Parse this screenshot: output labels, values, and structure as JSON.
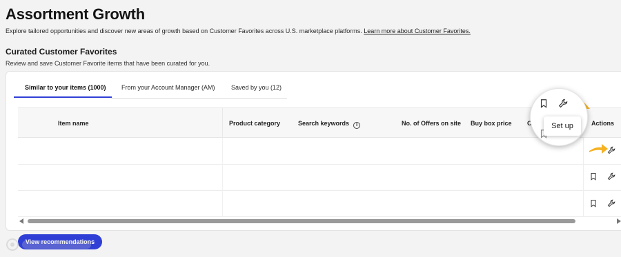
{
  "header": {
    "title": "Assortment Growth",
    "description": "Explore tailored opportunities and discover new areas of growth based on Customer Favorites across U.S. marketplace platforms.",
    "link": "Learn more about Customer Favorites."
  },
  "section": {
    "title": "Curated Customer Favorites",
    "description": "Review and save Customer Favorite items that have been curated for you."
  },
  "tabs": [
    {
      "label": "Similar to your items (1000)",
      "active": true
    },
    {
      "label": "From your Account Manager (AM)",
      "active": false
    },
    {
      "label": "Saved by you (12)",
      "active": false
    }
  ],
  "table": {
    "columns": [
      "Item name",
      "Product category",
      "Search keywords",
      "No. of Offers on site",
      "Buy box price",
      "C",
      "Actions"
    ],
    "rows": [
      {
        "actions": [
          "bookmark-icon",
          "wrench-icon"
        ]
      },
      {
        "actions": [
          "bookmark-icon",
          "wrench-icon"
        ]
      },
      {
        "actions": [
          "bookmark-icon",
          "wrench-icon"
        ]
      }
    ]
  },
  "magnifier": {
    "tooltip": "Set up",
    "icons": [
      "bookmark-icon",
      "wrench-icon"
    ]
  },
  "footer": {
    "button": "View recommendations"
  },
  "colors": {
    "accent": "#2f3fd6",
    "pointer": "#f5b223",
    "background": "#f3f3f3"
  }
}
